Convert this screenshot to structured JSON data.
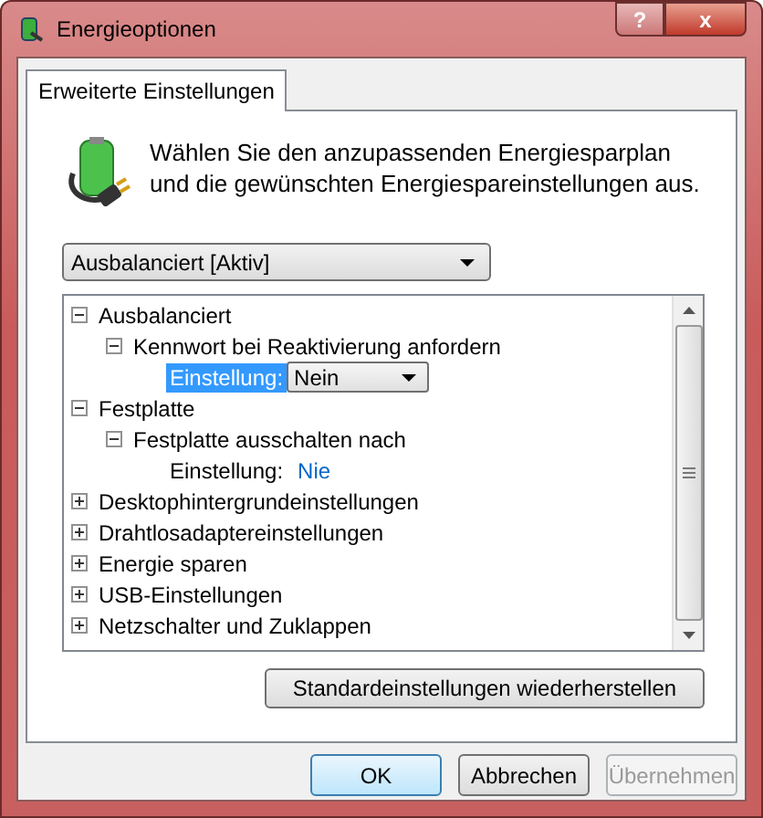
{
  "window": {
    "title": "Energieoptionen",
    "help": "?",
    "close": "x"
  },
  "tabs": [
    {
      "label": "Erweiterte Einstellungen",
      "selected": true
    }
  ],
  "description": "Wählen Sie den anzupassenden Energiesparplan und die gewünschten Energiespareinstellungen aus.",
  "plan_dropdown": {
    "value": "Ausbalanciert [Aktiv]"
  },
  "tree": [
    {
      "kind": "node",
      "label": "Ausbalanciert",
      "expanded": true,
      "children": [
        {
          "kind": "node",
          "label": "Kennwort bei Reaktivierung anfordern",
          "expanded": true,
          "children": [
            {
              "kind": "dropdown-setting",
              "label": "Einstellung:",
              "value": "Nein",
              "selected": true
            }
          ]
        }
      ]
    },
    {
      "kind": "node",
      "label": "Festplatte",
      "expanded": true,
      "children": [
        {
          "kind": "node",
          "label": "Festplatte ausschalten nach",
          "expanded": true,
          "children": [
            {
              "kind": "link-setting",
              "label": "Einstellung:",
              "value": "Nie",
              "selected": false
            }
          ]
        }
      ]
    },
    {
      "kind": "node",
      "label": "Desktophintergrundeinstellungen",
      "expanded": false
    },
    {
      "kind": "node",
      "label": "Drahtlosadaptereinstellungen",
      "expanded": false
    },
    {
      "kind": "node",
      "label": "Energie sparen",
      "expanded": false
    },
    {
      "kind": "node",
      "label": "USB-Einstellungen",
      "expanded": false
    },
    {
      "kind": "node",
      "label": "Netzschalter und Zuklappen",
      "expanded": false
    }
  ],
  "restore_button": "Standardeinstellungen wiederherstellen",
  "buttons": [
    {
      "label": "OK",
      "disabled": false,
      "default": true
    },
    {
      "label": "Abbrechen",
      "disabled": false,
      "default": false
    },
    {
      "label": "Übernehmen",
      "disabled": true,
      "default": false
    }
  ]
}
